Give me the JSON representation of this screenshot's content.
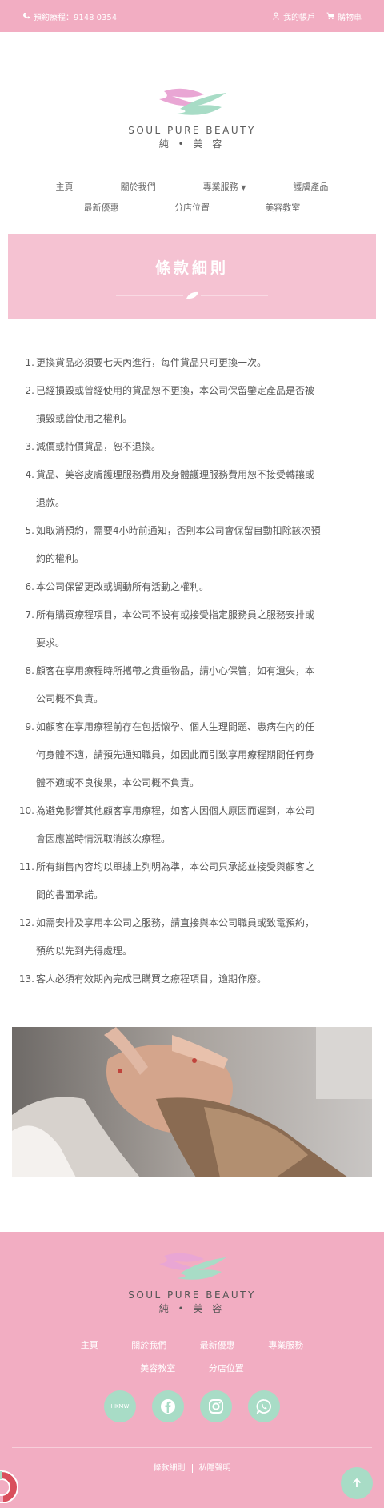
{
  "topbar": {
    "phone_label": "預約療程：9148 0354",
    "account_label": "我的帳戶",
    "cart_label": "購物車"
  },
  "brand": {
    "name": "SOUL PURE BEAUTY",
    "subname": "純 • 美 容"
  },
  "nav": {
    "row1": [
      "主頁",
      "關於我們",
      "專業服務",
      "護膚產品"
    ],
    "row2": [
      "最新優惠",
      "分店位置",
      "美容教室"
    ]
  },
  "banner": {
    "title": "條款細則"
  },
  "terms": [
    {
      "n": "1.",
      "lines": [
        "更換貨品必須要七天內進行，每件貨品只可更換一次。"
      ]
    },
    {
      "n": "2.",
      "lines": [
        "已經損毀或曾經使用的貨品恕不更換，本公司保留鑒定產品是否被",
        "損毀或曾使用之權利。"
      ]
    },
    {
      "n": "3.",
      "lines": [
        "減價或特價貨品，恕不退換。"
      ]
    },
    {
      "n": "4.",
      "lines": [
        "貨品、美容皮膚護理服務費用及身體護理服務費用恕不接受轉讓或",
        "退款。"
      ]
    },
    {
      "n": "5.",
      "lines": [
        "如取消預約，需要4小時前通知，否則本公司會保留自動扣除該次預",
        "約的權利。"
      ]
    },
    {
      "n": "6.",
      "lines": [
        "本公司保留更改或調動所有活動之權利。"
      ]
    },
    {
      "n": "7.",
      "lines": [
        "所有購買療程項目，本公司不設有或接受指定服務員之服務安排或",
        "要求。"
      ]
    },
    {
      "n": "8.",
      "lines": [
        "顧客在享用療程時所攜帶之貴重物品，請小心保管，如有遺失，本",
        "公司概不負責。"
      ]
    },
    {
      "n": "9.",
      "lines": [
        "如顧客在享用療程前存在包括懷孕、個人生理問題、患病在內的任",
        "何身體不適，請預先通知職員，如因此而引致享用療程期間任何身",
        "體不適或不良後果，本公司概不負責。"
      ]
    },
    {
      "n": "10.",
      "lines": [
        "為避免影響其他顧客享用療程，如客人因個人原因而遲到，本公司",
        "會因應當時情況取消該次療程。"
      ]
    },
    {
      "n": "11.",
      "lines": [
        "所有銷售內容均以單據上列明為準，本公司只承認並接受與顧客之",
        "間的書面承諾。"
      ]
    },
    {
      "n": "12.",
      "lines": [
        "如需安排及享用本公司之服務，請直接與本公司職員或致電預約，",
        "預約以先到先得處理。"
      ]
    },
    {
      "n": "13.",
      "lines": [
        "客人必須有效期內完成已購買之療程項目，逾期作廢。"
      ]
    }
  ],
  "footer": {
    "nav_row1": [
      "主頁",
      "關於我們",
      "最新優惠",
      "專業服務"
    ],
    "nav_row2": [
      "美容教室",
      "分店位置"
    ],
    "social": [
      {
        "icon": "hkmw-icon",
        "label": "HKMW"
      },
      {
        "icon": "facebook-icon"
      },
      {
        "icon": "instagram-icon"
      },
      {
        "icon": "whatsapp-icon"
      }
    ],
    "terms_link": "條款細則",
    "privacy_link": "私隱聲明"
  },
  "colors": {
    "pink": "#f2adc2",
    "banner_pink": "#f5c2d2",
    "mint": "#a8dcc6"
  }
}
